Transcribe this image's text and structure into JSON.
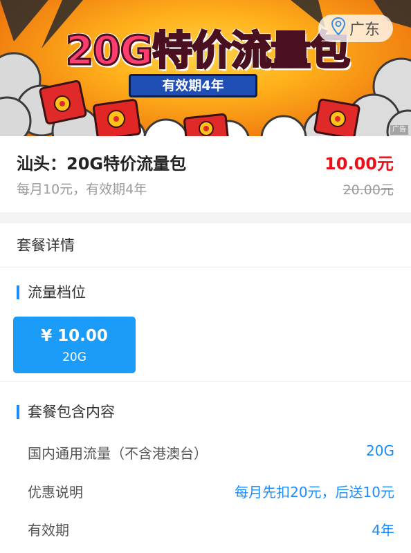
{
  "banner": {
    "title": "20G特价流量包",
    "validity": "有效期4年",
    "region": "广东",
    "ad_tag": "广告",
    "icons": [
      "location-pin-icon",
      "red-envelope-icon"
    ],
    "colors": {
      "background": "#ffb11b",
      "title": "#ff3d6e",
      "validity_badge": "#1f4fb5"
    }
  },
  "product": {
    "name": "汕头：20G特价流量包",
    "description": "每月10元，有效期4年",
    "price": "10.00元",
    "original_price": "20.00元",
    "colors": {
      "price": "#e8101a"
    }
  },
  "details": {
    "section_title": "套餐详情",
    "tier_heading": "流量档位",
    "tiers": [
      {
        "price": "¥ 10.00",
        "size": "20G",
        "selected": true
      }
    ],
    "content_heading": "套餐包含内容",
    "rows": [
      {
        "label": "国内通用流量（不含港澳台）",
        "value": "20G"
      },
      {
        "label": "优惠说明",
        "value": "每月先扣20元，后送10元"
      },
      {
        "label": "有效期",
        "value": "4年"
      }
    ],
    "colors": {
      "accent": "#1a8cff",
      "tier_card": "#1a9cf8"
    }
  }
}
